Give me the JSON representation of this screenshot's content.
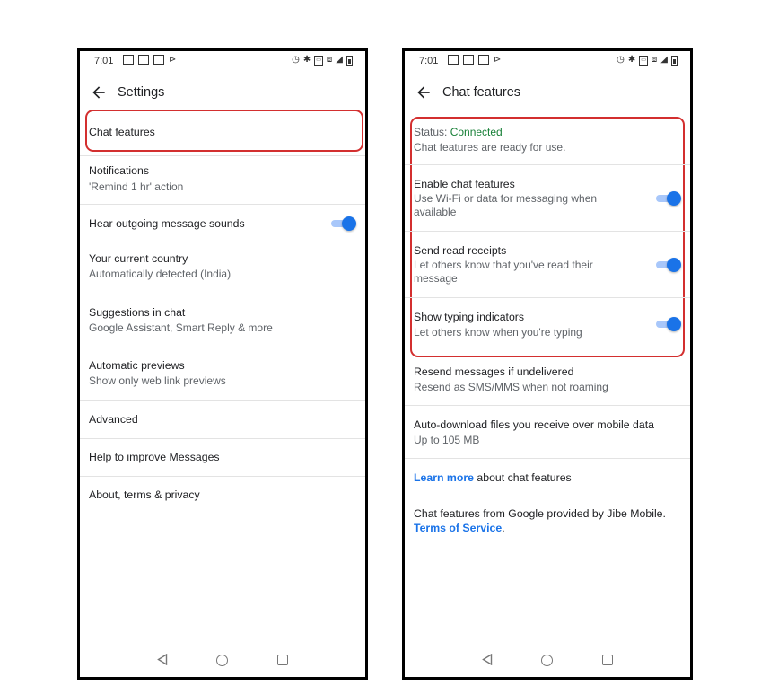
{
  "status_bar": {
    "time": "7:01"
  },
  "settings": {
    "title": "Settings",
    "items": [
      {
        "title": "Chat features",
        "subtitle": ""
      },
      {
        "title": "Notifications",
        "subtitle": "'Remind 1 hr' action"
      },
      {
        "title": "Hear outgoing message sounds",
        "subtitle": "",
        "toggle": true
      },
      {
        "title": "Your current country",
        "subtitle": "Automatically detected (India)"
      },
      {
        "title": "Suggestions in chat",
        "subtitle": "Google Assistant, Smart Reply & more"
      },
      {
        "title": "Automatic previews",
        "subtitle": "Show only web link previews"
      },
      {
        "title": "Advanced",
        "subtitle": ""
      },
      {
        "title": "Help to improve Messages",
        "subtitle": ""
      },
      {
        "title": "About, terms & privacy",
        "subtitle": ""
      }
    ]
  },
  "chat_features": {
    "title": "Chat features",
    "status_label": "Status: ",
    "status_value": "Connected",
    "status_sub": "Chat features are ready for use.",
    "enable": {
      "title": "Enable chat features",
      "subtitle": "Use Wi-Fi or data for messaging when available",
      "toggle": true
    },
    "receipts": {
      "title": "Send read receipts",
      "subtitle": "Let others know that you've read their message",
      "toggle": true
    },
    "typing": {
      "title": "Show typing indicators",
      "subtitle": "Let others know when you're typing",
      "toggle": true
    },
    "resend": {
      "title": "Resend messages if undelivered",
      "subtitle": "Resend as SMS/MMS when not roaming"
    },
    "autodownload": {
      "title": "Auto-download files you receive over mobile data",
      "subtitle": "Up to 105 MB"
    },
    "learn_more_link": "Learn more",
    "learn_more_rest": " about chat features",
    "provider_text": "Chat features from Google provided by Jibe Mobile.",
    "terms_link": "Terms of Service",
    "terms_period": "."
  },
  "icons": {
    "back": "arrow-left-icon",
    "nav_back": "triangle-back-icon",
    "nav_home": "circle-home-icon",
    "nav_recents": "square-recents-icon"
  },
  "colors": {
    "accent": "#1a73e8",
    "toggle_track": "#a8c7fa",
    "connected": "#188038",
    "highlight": "#d32f2f"
  }
}
